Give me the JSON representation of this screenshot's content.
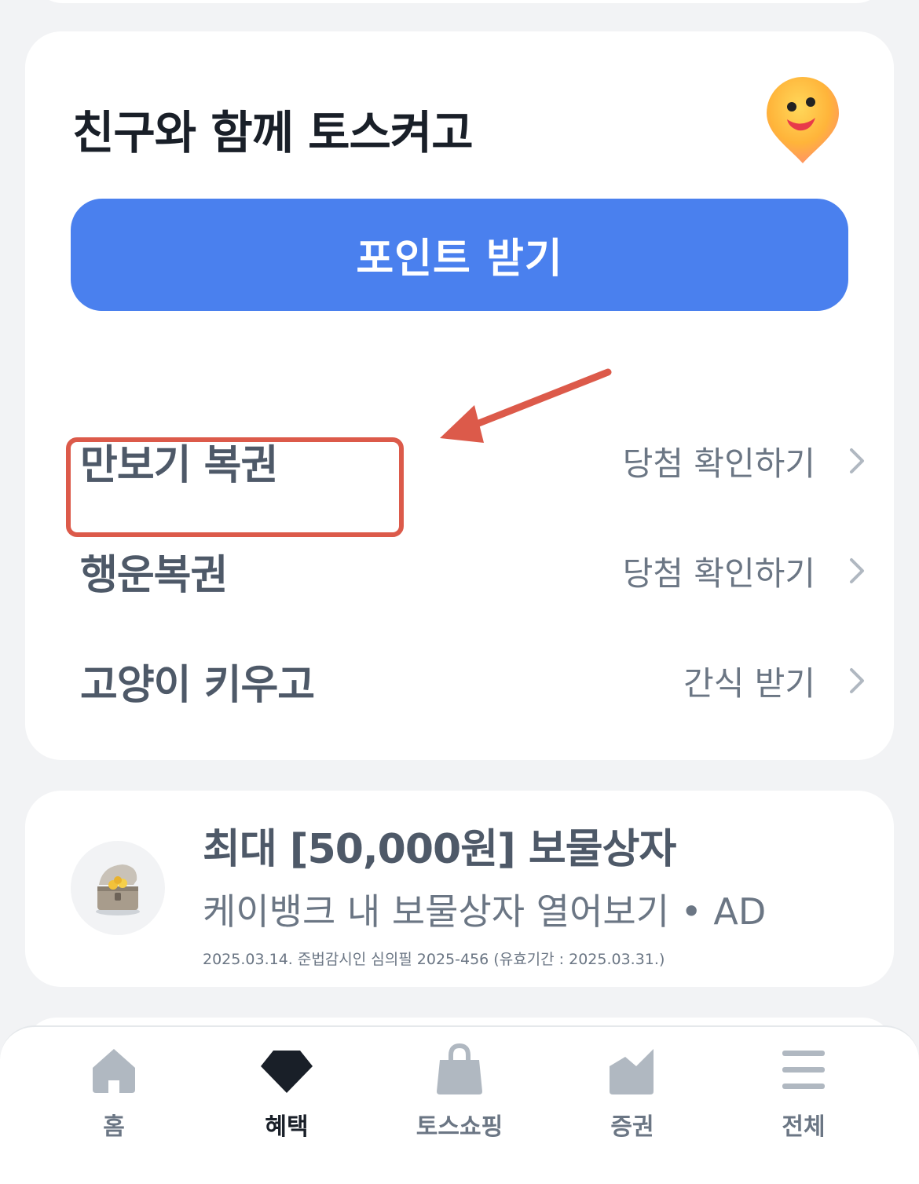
{
  "card": {
    "title": "친구와 함께 토스켜고",
    "primary_button": "포인트 받기",
    "rows": [
      {
        "title": "만보기 복권",
        "action": "당첨 확인하기"
      },
      {
        "title": "행운복권",
        "action": "당첨 확인하기"
      },
      {
        "title": "고양이 키우고",
        "action": "간식 받기"
      }
    ]
  },
  "ad": {
    "title": "최대 [50,000원] 보물상자",
    "subtitle": "케이뱅크 내 보물상자 열어보기 • AD",
    "fine_print": "2025.03.14. 준법감시인 심의필 2025-456 (유효기간 : 2025.03.31.)"
  },
  "tabbar": {
    "tabs": [
      {
        "label": "홈",
        "icon": "home-icon"
      },
      {
        "label": "혜택",
        "icon": "diamond-icon",
        "active": true
      },
      {
        "label": "토스쇼핑",
        "icon": "shopping-bag-icon"
      },
      {
        "label": "증권",
        "icon": "chart-icon"
      },
      {
        "label": "전체",
        "icon": "menu-icon"
      }
    ]
  },
  "colors": {
    "accent_blue": "#4a80ee",
    "annotation_red": "#dc5a4a",
    "background": "#f2f3f5"
  }
}
